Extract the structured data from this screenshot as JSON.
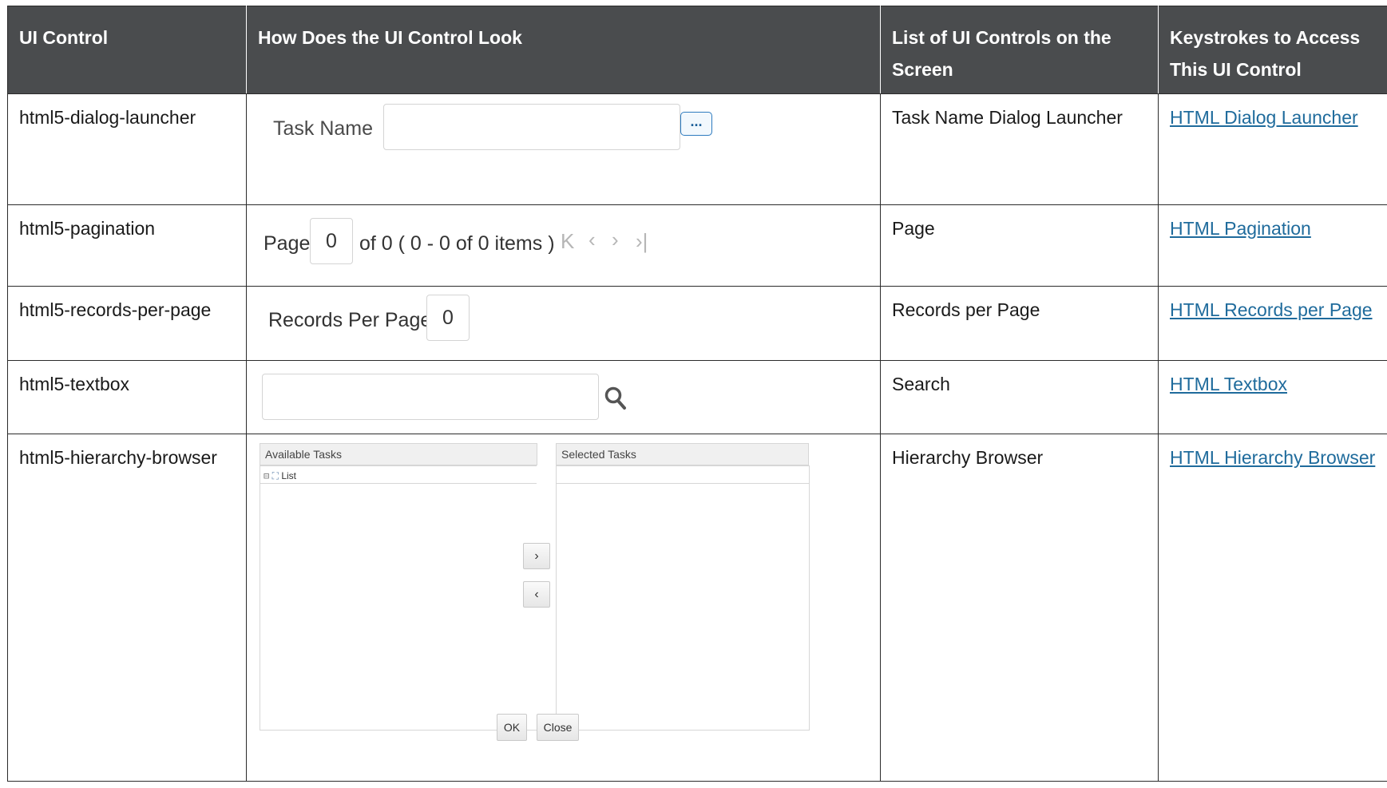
{
  "headers": [
    "UI Control",
    "How Does the UI Control Look",
    "List of UI Controls on the Screen",
    "Keystrokes to Access This UI Control"
  ],
  "rows": [
    {
      "control": "html5-dialog-launcher",
      "screen_control": "Task Name Dialog Launcher",
      "keystroke_link": "HTML Dialog Launcher",
      "preview": {
        "label": "Task Name",
        "button": "..."
      }
    },
    {
      "control": "html5-pagination",
      "screen_control": "Page",
      "keystroke_link": "HTML Pagination",
      "preview": {
        "page_label": "Page",
        "page_value": "0",
        "summary": "of 0 ( 0 - 0 of 0 items )"
      }
    },
    {
      "control": "html5-records-per-page",
      "screen_control": "Records per Page",
      "keystroke_link": "HTML Records per Page",
      "preview": {
        "label": "Records Per Page",
        "value": "0"
      }
    },
    {
      "control": "html5-textbox",
      "screen_control": "Search",
      "keystroke_link": "HTML Textbox",
      "preview": {
        "icon": "search-icon"
      }
    },
    {
      "control": "html5-hierarchy-browser",
      "screen_control": "Hierarchy Browser",
      "keystroke_link": "HTML Hierarchy Browser",
      "preview": {
        "available_header": "Available Tasks",
        "selected_header": "Selected Tasks",
        "tree_item": "List",
        "ok": "OK",
        "close": "Close"
      }
    }
  ]
}
